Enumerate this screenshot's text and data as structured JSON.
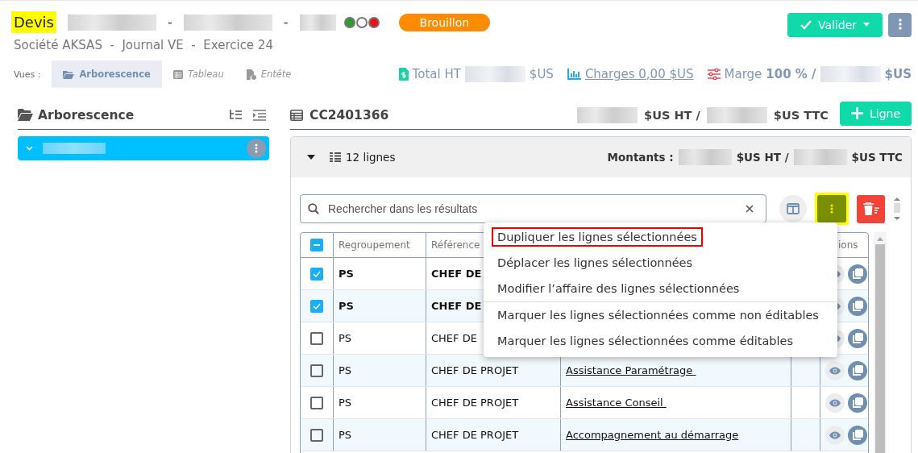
{
  "header": {
    "title": "Devis",
    "separators": [
      "-",
      "-"
    ],
    "status_dots": [
      {
        "color": "#2e9b2e"
      },
      {
        "color": "#ffffff"
      },
      {
        "color": "#ee1111"
      }
    ],
    "badge": "Brouillon",
    "subtitle": "Société AKSAS  -  Journal VE  -  Exercice 24",
    "validate_button": "Valider"
  },
  "views": {
    "label": "Vues :",
    "tabs": [
      {
        "label": "Arborescence",
        "selected": true
      },
      {
        "label": "Tableau",
        "selected": false
      },
      {
        "label": "Entête",
        "selected": false
      }
    ]
  },
  "totals": {
    "total_label": "Total HT",
    "total_currency": "$US",
    "charges": "Charges 0,00 $US",
    "margin_label": "Marge",
    "margin_value": "100 % /",
    "margin_currency": "$US"
  },
  "tree": {
    "title": "Arborescence",
    "items": [
      {
        "expanded": true,
        "selected": true
      }
    ]
  },
  "document": {
    "code": "CC2401366",
    "amount_ht": "$US HT /",
    "amount_ttc": "$US TTC",
    "add_button": "Ligne"
  },
  "group": {
    "expanded": true,
    "count": "12 lignes",
    "amounts_label": "Montants :",
    "amount_ht": "$US HT /",
    "amount_ttc": "$US TTC"
  },
  "search": {
    "placeholder": "Rechercher dans les résultats"
  },
  "table": {
    "select_all": {
      "partially_selected": true
    },
    "column_1": "Regroupement",
    "column_2": "Référence",
    "column_5": "ions",
    "rows": [
      {
        "selected": true,
        "group": "PS",
        "reference": "CHEF DE"
      },
      {
        "selected": true,
        "group": "PS",
        "reference": "CHEF DE"
      },
      {
        "selected": false,
        "group": "PS",
        "reference": "CHEF DE"
      },
      {
        "selected": false,
        "group": "PS",
        "reference": "CHEF DE PROJET",
        "designation": "Assistance Paramétrage "
      },
      {
        "selected": false,
        "group": "PS",
        "reference": "CHEF DE PROJET",
        "designation": "Assistance Conseil "
      },
      {
        "selected": false,
        "group": "PS",
        "reference": "CHEF DE PROJET",
        "designation": "Accompagnement au démarrage"
      }
    ]
  },
  "menu": {
    "groups": [
      {
        "items": [
          {
            "label": "Dupliquer les lignes sélectionnées",
            "highlighted": true
          },
          {
            "label": "Déplacer les lignes sélectionnées",
            "highlighted": false
          },
          {
            "label": "Modifier l’affaire des lignes sélectionnées",
            "highlighted": false
          }
        ]
      },
      {
        "items": [
          {
            "label": "Marquer les lignes sélectionnées comme non éditables",
            "highlighted": false
          },
          {
            "label": "Marquer les lignes sélectionnées comme éditables",
            "highlighted": false
          }
        ]
      }
    ]
  }
}
